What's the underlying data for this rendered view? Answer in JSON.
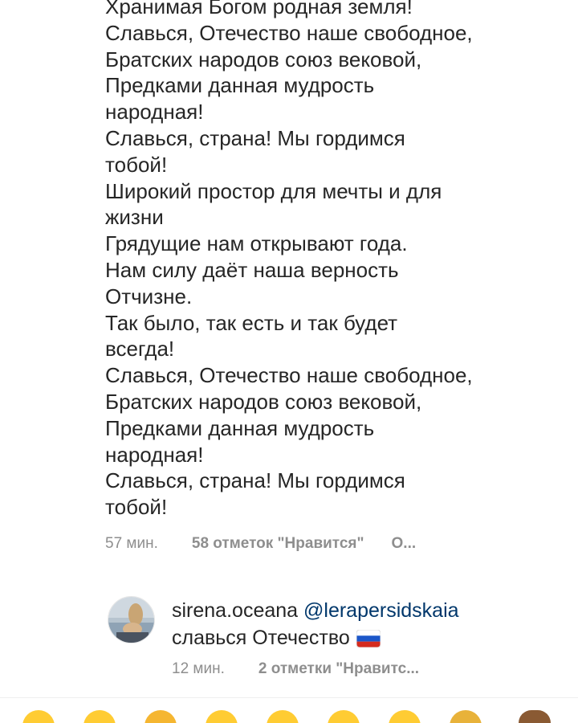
{
  "comment": {
    "lines": [
      "Хранимая Богом родная земля!",
      "Славься, Отечество наше свободное,",
      "Братских народов союз вековой,",
      "Предками данная мудрость",
      "народная!",
      "Славься, страна! Мы гордимся",
      "тобой!",
      "Широкий простор для мечты и для",
      "жизни",
      "Грядущие нам открывают года.",
      "Нам силу даёт наша верность",
      "Отчизне.",
      "Так было, так есть и так будет",
      "всегда!",
      "Славься, Отечество наше свободное,",
      "Братских народов союз вековой,",
      "Предками данная мудрость",
      "народная!",
      "Славься, страна! Мы гордимся",
      "тобой!"
    ],
    "time": "57 мин.",
    "likes": "58 отметок \"Нравится\"",
    "more": "О..."
  },
  "reply": {
    "username": "sirena.oceana",
    "mention": "@lerapersidskaia",
    "text": "славься Отечество",
    "flag_icon": "russia-flag-icon",
    "time": "12 мин.",
    "likes": "2 отметки \"Нравитс..."
  },
  "emoji_bar": {
    "icons": [
      "emoji-icon",
      "emoji-icon",
      "emoji-icon",
      "emoji-icon",
      "emoji-icon",
      "emoji-icon",
      "emoji-icon",
      "emoji-icon",
      "bear-emoji-icon"
    ]
  }
}
